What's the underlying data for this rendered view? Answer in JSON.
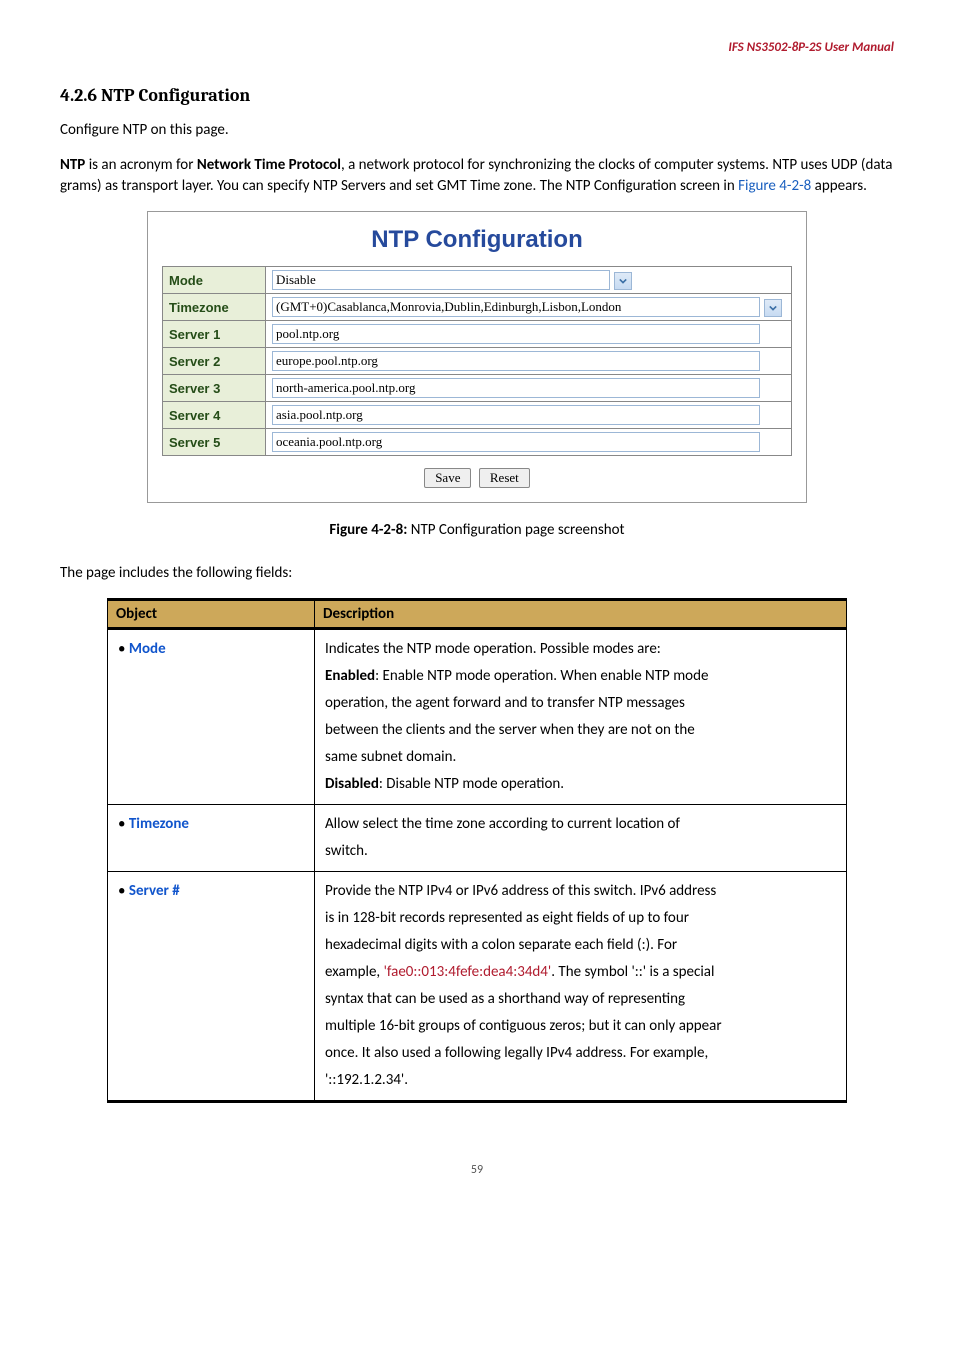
{
  "header": "IFS  NS3502-8P-2S  User  Manual",
  "section_title": "4.2.6 NTP Configuration",
  "intro_para": "Configure NTP on this page.",
  "desc_para_parts": {
    "p1": "NTP",
    "p2": " is an acronym for ",
    "p3": "Network Time Protocol",
    "p4": ", a network protocol for synchronizing the clocks of computer systems. NTP uses UDP (data grams) as transport layer. You can specify NTP Servers and set GMT Time zone. The NTP Configuration screen in ",
    "p5": "Figure 4-2-8",
    "p6": " appears."
  },
  "config": {
    "title": "NTP Configuration",
    "rows": {
      "mode_label": "Mode",
      "mode_value": "Disable",
      "tz_label": "Timezone",
      "tz_value": "(GMT+0)Casablanca,Monrovia,Dublin,Edinburgh,Lisbon,London",
      "s1_label": "Server 1",
      "s1_value": "pool.ntp.org",
      "s2_label": "Server 2",
      "s2_value": "europe.pool.ntp.org",
      "s3_label": "Server 3",
      "s3_value": "north-america.pool.ntp.org",
      "s4_label": "Server 4",
      "s4_value": "asia.pool.ntp.org",
      "s5_label": "Server 5",
      "s5_value": "oceania.pool.ntp.org"
    },
    "buttons": {
      "save": "Save",
      "reset": "Reset"
    }
  },
  "caption_parts": {
    "b": "Figure 4-2-8:",
    "rest": " NTP Configuration page screenshot"
  },
  "fields_intro": "The page includes the following fields:",
  "table": {
    "h_object": "Object",
    "h_desc": "Description",
    "mode_label": "Mode",
    "mode_desc": {
      "l1": "Indicates the NTP mode operation. Possible modes are:",
      "l2a": "Enabled",
      "l2b": ": Enable NTP mode operation. When enable NTP mode",
      "l3": "operation, the agent forward and to transfer NTP messages",
      "l4": "between the clients and the server when they are not on the",
      "l5": "same subnet domain.",
      "l6a": "Disabled",
      "l6b": ": Disable NTP mode operation."
    },
    "tz_label": "Timezone",
    "tz_desc": {
      "l1": "Allow select the time zone according to current location of",
      "l2": "switch."
    },
    "srv_label": "Server #",
    "srv_desc": {
      "l1": "Provide the NTP IPv4 or IPv6 address of this switch. IPv6 address",
      "l2": "is in 128-bit records represented as eight fields of up to four",
      "l3": "hexadecimal digits with a colon separate each field (:). For",
      "l4a": "example, ",
      "l4b": "'fae0::013:4fefe:dea4:34d4'",
      "l4c": ". The symbol '::' is a special",
      "l5": "syntax that can be used as a shorthand way of representing",
      "l6": "multiple 16-bit groups of contiguous zeros; but it can only appear",
      "l7": "once. It also used a following legally IPv4 address. For example,",
      "l8": "'::192.1.2.34'."
    }
  },
  "pagenum": "59"
}
